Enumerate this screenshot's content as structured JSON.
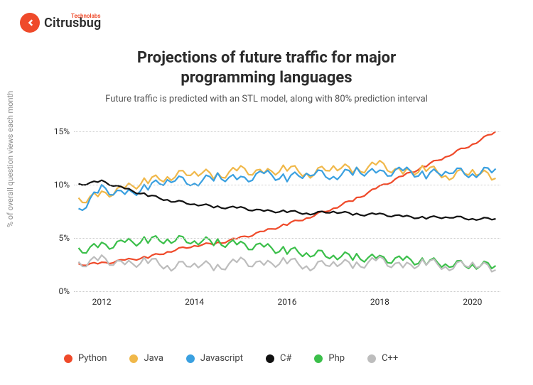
{
  "logo": {
    "brand": "Citrusbug",
    "sub": "Technolabs"
  },
  "title_line1": "Projections of future traffic for  major",
  "title_line2": "programming languages",
  "subtitle": "Future traffic is predicted with an STL model, along with 80% prediction interval",
  "ylabel": "% of overall question views each month",
  "chart_data": {
    "type": "line",
    "xlabel": "",
    "ylabel": "% of overall question views each month",
    "title": "Projections of future traffic for major programming languages",
    "x_ticks": [
      "2012",
      "2014",
      "2016",
      "2018",
      "2020"
    ],
    "y_ticks": [
      "0%",
      "5%",
      "10%",
      "15%"
    ],
    "ylim": [
      0,
      16
    ],
    "xlim": [
      2011.4,
      2020.6
    ],
    "legend_position": "bottom",
    "series": [
      {
        "name": "Python",
        "color": "#ef4a2a",
        "x": [
          2011.5,
          2012,
          2012.5,
          2013,
          2013.5,
          2014,
          2014.5,
          2015,
          2015.5,
          2016,
          2016.5,
          2017,
          2017.5,
          2018,
          2018.5,
          2019,
          2019.5,
          2020,
          2020.5
        ],
        "y": [
          2.5,
          2.6,
          2.9,
          3.2,
          3.8,
          4.3,
          4.5,
          5.0,
          5.6,
          6.3,
          7.0,
          7.8,
          8.7,
          9.8,
          10.8,
          11.8,
          12.8,
          13.8,
          15.0
        ]
      },
      {
        "name": "Java",
        "color": "#f0b84a",
        "x": [
          2011.5,
          2012,
          2012.5,
          2013,
          2013.5,
          2014,
          2014.5,
          2015,
          2015.5,
          2016,
          2016.5,
          2017,
          2017.5,
          2018,
          2018.5,
          2019,
          2019.5,
          2020,
          2020.5
        ],
        "y": [
          8.5,
          9.0,
          9.6,
          10.4,
          10.8,
          11.3,
          10.8,
          11.4,
          11.0,
          11.6,
          11.0,
          11.8,
          11.3,
          11.9,
          11.0,
          11.6,
          10.8,
          11.4,
          10.6
        ]
      },
      {
        "name": "Javascript",
        "color": "#3aa0e0",
        "x": [
          2011.5,
          2012,
          2012.5,
          2013,
          2013.5,
          2014,
          2014.5,
          2015,
          2015.5,
          2016,
          2016.5,
          2017,
          2017.5,
          2018,
          2018.5,
          2019,
          2019.5,
          2020,
          2020.5
        ],
        "y": [
          7.5,
          9.6,
          9.0,
          9.8,
          10.6,
          10.2,
          10.8,
          10.4,
          11.0,
          10.6,
          11.2,
          10.8,
          11.3,
          11.0,
          11.3,
          10.9,
          11.4,
          11.0,
          11.5
        ]
      },
      {
        "name": "C#",
        "color": "#111111",
        "x": [
          2011.5,
          2012,
          2012.5,
          2013,
          2013.5,
          2014,
          2014.5,
          2015,
          2015.5,
          2016,
          2016.5,
          2017,
          2017.5,
          2018,
          2018.5,
          2019,
          2019.5,
          2020,
          2020.5
        ],
        "y": [
          10.0,
          10.3,
          9.6,
          9.0,
          8.5,
          8.2,
          7.9,
          7.8,
          7.5,
          7.5,
          7.3,
          7.5,
          7.2,
          7.2,
          7.0,
          6.9,
          7.0,
          6.8,
          6.8
        ]
      },
      {
        "name": "Php",
        "color": "#3bbf4a",
        "x": [
          2011.5,
          2012,
          2012.5,
          2013,
          2013.5,
          2014,
          2014.5,
          2015,
          2015.5,
          2016,
          2016.5,
          2017,
          2017.5,
          2018,
          2018.5,
          2019,
          2019.5,
          2020,
          2020.5
        ],
        "y": [
          3.8,
          4.2,
          4.5,
          4.8,
          4.9,
          4.8,
          4.6,
          4.3,
          4.1,
          3.8,
          3.6,
          3.4,
          3.2,
          3.0,
          2.9,
          2.8,
          2.6,
          2.5,
          2.4
        ]
      },
      {
        "name": "C++",
        "color": "#bdbdbd",
        "x": [
          2011.5,
          2012,
          2012.5,
          2013,
          2013.5,
          2014,
          2014.5,
          2015,
          2015.5,
          2016,
          2016.5,
          2017,
          2017.5,
          2018,
          2018.5,
          2019,
          2019.5,
          2020,
          2020.5
        ],
        "y": [
          2.5,
          3.0,
          2.4,
          2.9,
          2.3,
          2.7,
          2.2,
          2.8,
          2.4,
          2.9,
          2.3,
          2.8,
          2.4,
          2.9,
          2.2,
          2.8,
          2.3,
          2.7,
          2.0
        ]
      }
    ]
  },
  "legend": [
    {
      "label": "Python",
      "color": "#ef4a2a"
    },
    {
      "label": "Java",
      "color": "#f0b84a"
    },
    {
      "label": "Javascript",
      "color": "#3aa0e0"
    },
    {
      "label": "C#",
      "color": "#111111"
    },
    {
      "label": "Php",
      "color": "#3bbf4a"
    },
    {
      "label": "C++",
      "color": "#bdbdbd"
    }
  ]
}
